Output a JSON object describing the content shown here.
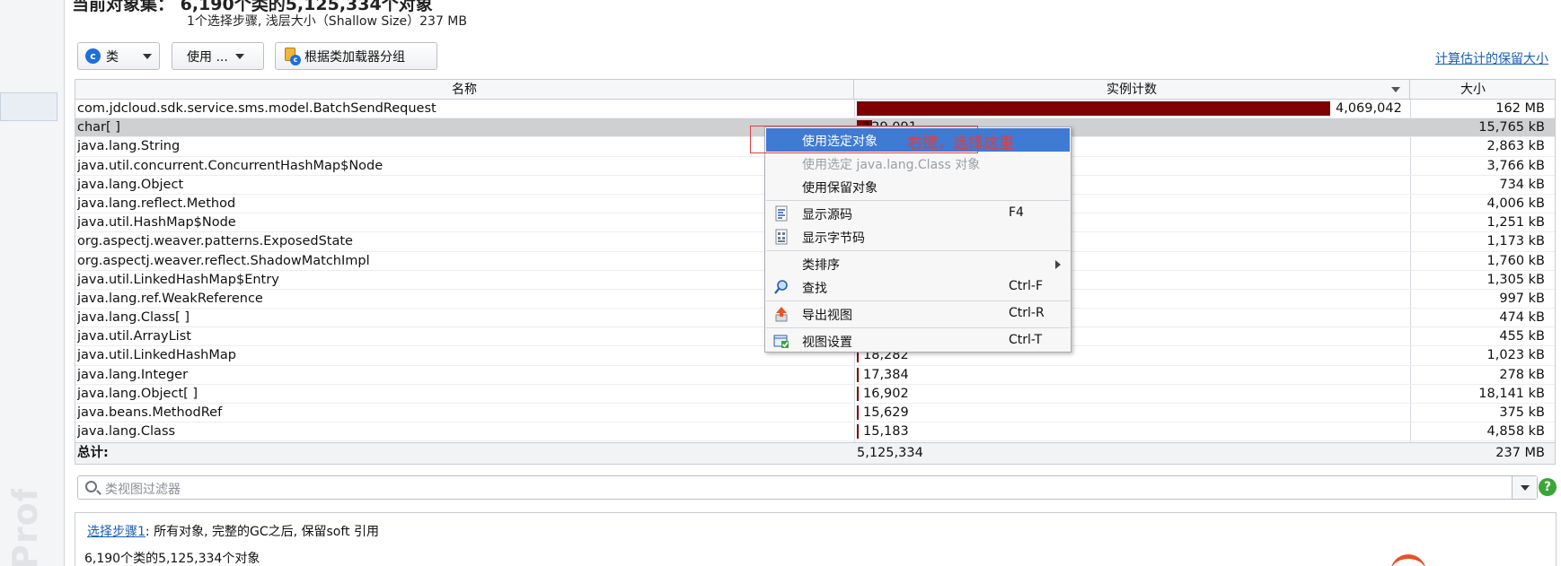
{
  "header": {
    "title": "当前对象集：  6,190个类的5,125,334个对象",
    "subtitle": "1个选择步骤, 浅层大小（Shallow Size）237 MB"
  },
  "toolbar": {
    "class_view_label": "类",
    "use_label": "使用 ...",
    "group_by_loader_label": "根据类加载器分组",
    "calc_retained_link": "计算估计的保留大小"
  },
  "table": {
    "columns": [
      "名称",
      "实例计数",
      "大小"
    ],
    "rows": [
      {
        "name": "com.jdcloud.sdk.service.sms.model.BatchSendRequest",
        "count": "4,069,042",
        "count_fraction": 1.0,
        "size": "162 MB"
      },
      {
        "name": "char[ ]",
        "count": "129,091",
        "count_fraction": 0.032,
        "size": "15,765 kB"
      },
      {
        "name": "java.lang.String",
        "count": "",
        "count_fraction": 0.03,
        "size": "2,863 kB"
      },
      {
        "name": "java.util.concurrent.ConcurrentHashMap$Node",
        "count": "",
        "count_fraction": 0.02,
        "size": "3,766 kB"
      },
      {
        "name": "java.lang.Object",
        "count": "",
        "count_fraction": 0.02,
        "size": "734 kB"
      },
      {
        "name": "java.lang.reflect.Method",
        "count": "",
        "count_fraction": 0.01,
        "size": "4,006 kB"
      },
      {
        "name": "java.util.HashMap$Node",
        "count": "",
        "count_fraction": 0.01,
        "size": "1,251 kB"
      },
      {
        "name": "org.aspectj.weaver.patterns.ExposedState",
        "count": "",
        "count_fraction": 0.01,
        "size": "1,173 kB"
      },
      {
        "name": "org.aspectj.weaver.reflect.ShadowMatchImpl",
        "count": "",
        "count_fraction": 0.01,
        "size": "1,760 kB"
      },
      {
        "name": "java.util.LinkedHashMap$Entry",
        "count": "",
        "count_fraction": 0.01,
        "size": "1,305 kB"
      },
      {
        "name": "java.lang.ref.WeakReference",
        "count": "",
        "count_fraction": 0.01,
        "size": "997 kB"
      },
      {
        "name": "java.lang.Class[ ]",
        "count": "",
        "count_fraction": 0.01,
        "size": "474 kB"
      },
      {
        "name": "java.util.ArrayList",
        "count": "",
        "count_fraction": 0.01,
        "size": "455 kB"
      },
      {
        "name": "java.util.LinkedHashMap",
        "count": "18,282",
        "count_fraction": 0.004,
        "size": "1,023 kB"
      },
      {
        "name": "java.lang.Integer",
        "count": "17,384",
        "count_fraction": 0.004,
        "size": "278 kB"
      },
      {
        "name": "java.lang.Object[ ]",
        "count": "16,902",
        "count_fraction": 0.004,
        "size": "18,141 kB"
      },
      {
        "name": "java.beans.MethodRef",
        "count": "15,629",
        "count_fraction": 0.004,
        "size": "375 kB"
      },
      {
        "name": "java.lang.Class",
        "count": "15,183",
        "count_fraction": 0.004,
        "size": "4,858 kB"
      }
    ],
    "total": {
      "label": "总计:",
      "count": "5,125,334",
      "size": "237 MB"
    }
  },
  "filter": {
    "placeholder": "类视图过滤器"
  },
  "info": {
    "step_link": "选择步骤1",
    "step_text": ": 所有对象, 完整的GC之后, 保留soft 引用",
    "summary": "6,190个类的5,125,334个对象"
  },
  "annotation": {
    "text": "右键，选择这里"
  },
  "context_menu": {
    "use_selected": "使用选定对象",
    "use_class_objects": "使用选定 java.lang.Class 对象",
    "use_retained": "使用保留对象",
    "show_source": "显示源码",
    "show_source_sc": "F4",
    "show_bytecode": "显示字节码",
    "sort_classes": "类排序",
    "find": "查找",
    "find_sc": "Ctrl-F",
    "export_view": "导出视图",
    "export_view_sc": "Ctrl-R",
    "view_settings": "视图设置",
    "view_settings_sc": "Ctrl-T"
  },
  "sidebar": {
    "watermark": "Profiler"
  },
  "colors": {
    "bar": "#7e0000",
    "menu_highlight": "#3f7ad3",
    "link": "#1a5fb4",
    "annotation": "#e83a3a"
  }
}
